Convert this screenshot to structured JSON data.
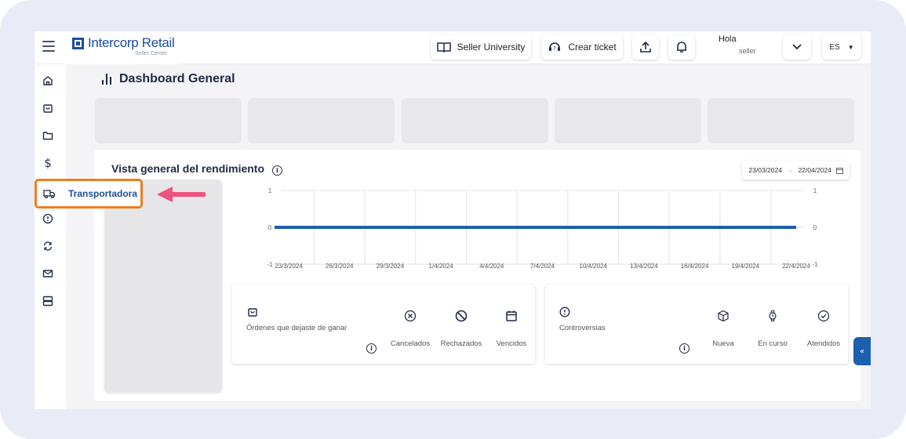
{
  "brand": {
    "name": "Intercorp Retail",
    "sub": "Seller Center"
  },
  "topbar": {
    "seller_university": "Seller University",
    "crear_ticket": "Crear ticket",
    "greeting": "Hola",
    "user": "seller",
    "language": "ES"
  },
  "page": {
    "title": "Dashboard General"
  },
  "panel": {
    "title": "Vista general del rendimiento",
    "date_from": "23/03/2024",
    "date_to": "22/04/2024"
  },
  "highlight": {
    "label": "Transportadora"
  },
  "chart_data": {
    "type": "line",
    "x": [
      "23/3/2024",
      "26/3/2024",
      "29/3/2024",
      "1/4/2024",
      "4/4/2024",
      "7/4/2024",
      "10/4/2024",
      "13/4/2024",
      "16/4/2024",
      "19/4/2024",
      "22/4/2024"
    ],
    "series": [
      {
        "values": [
          0,
          0,
          0,
          0,
          0,
          0,
          0,
          0,
          0,
          0,
          0
        ]
      }
    ],
    "y_ticks": [
      "1",
      "0",
      "-1"
    ],
    "ylim": [
      -1,
      1
    ],
    "line_color": "#1d5fae",
    "grid": true
  },
  "orders_card": {
    "label": "Órdenes que dejaste de ganar",
    "cols": [
      "Cancelados",
      "Rechazados",
      "Vencidos"
    ]
  },
  "controversias_card": {
    "label": "Controversias",
    "cols": [
      "Nueva",
      "En curso",
      "Atendidos"
    ]
  },
  "colors": {
    "accent": "#1d5fae",
    "highlight": "#f07d1e",
    "arrow": "#f0527e"
  }
}
